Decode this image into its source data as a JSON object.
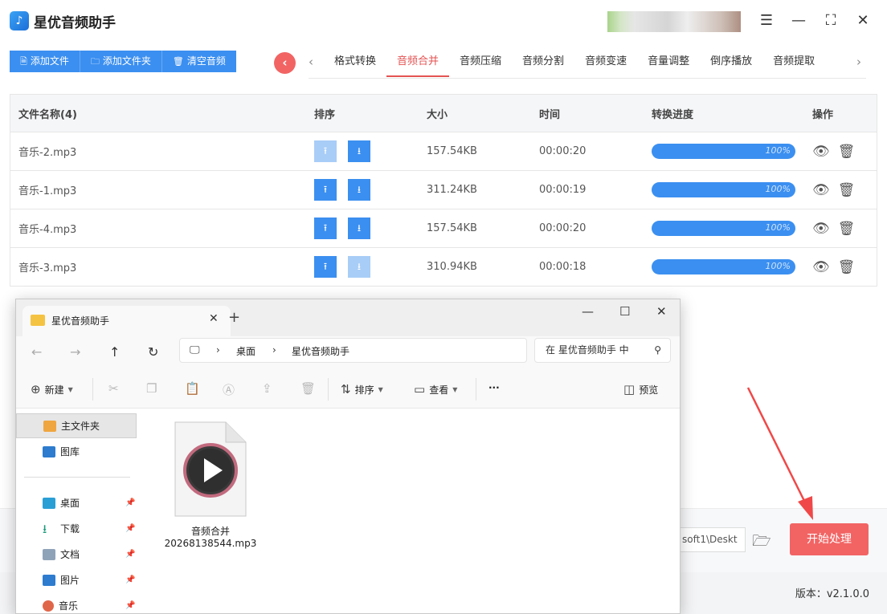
{
  "app": {
    "title": "星优音频助手",
    "version": "版本：v2.1.0.0"
  },
  "toolbar": {
    "add_file": "添加文件",
    "add_folder": "添加文件夹",
    "clear_audio": "清空音频"
  },
  "tabs": [
    "格式转换",
    "音频合并",
    "音频压缩",
    "音频分割",
    "音频变速",
    "音量调整",
    "倒序播放",
    "音频提取"
  ],
  "active_tab": "音频合并",
  "table": {
    "headers": {
      "name": "文件名称(4)",
      "sort": "排序",
      "size": "大小",
      "time": "时间",
      "progress": "转换进度",
      "ops": "操作"
    },
    "rows": [
      {
        "name": "音乐-2.mp3",
        "size": "157.54KB",
        "time": "00:00:20",
        "progress_text": "100%",
        "progress": 1.0,
        "up_enabled": false,
        "down_enabled": true
      },
      {
        "name": "音乐-1.mp3",
        "size": "311.24KB",
        "time": "00:00:19",
        "progress_text": "100%",
        "progress": 1.0,
        "up_enabled": true,
        "down_enabled": true
      },
      {
        "name": "音乐-4.mp3",
        "size": "157.54KB",
        "time": "00:00:20",
        "progress_text": "100%",
        "progress": 1.0,
        "up_enabled": true,
        "down_enabled": true
      },
      {
        "name": "音乐-3.mp3",
        "size": "310.94KB",
        "time": "00:00:18",
        "progress_text": "100%",
        "progress": 1.0,
        "up_enabled": true,
        "down_enabled": false
      }
    ]
  },
  "output": {
    "path": "soft1\\Deskt",
    "start_button": "开始处理"
  },
  "explorer": {
    "tab_title": "星优音频助手",
    "address": [
      "桌面",
      "星优音频助手"
    ],
    "search_placeholder": "在 星优音频助手 中",
    "commands": {
      "new": "新建",
      "sort": "排序",
      "view": "查看",
      "more": "···",
      "preview": "预览"
    },
    "sidebar": [
      {
        "label": "主文件夹",
        "selected": true,
        "pinned": false
      },
      {
        "label": "图库",
        "selected": false,
        "pinned": false
      },
      {
        "label": "桌面",
        "selected": false,
        "pinned": true
      },
      {
        "label": "下载",
        "selected": false,
        "pinned": true
      },
      {
        "label": "文档",
        "selected": false,
        "pinned": true
      },
      {
        "label": "图片",
        "selected": false,
        "pinned": true
      },
      {
        "label": "音乐",
        "selected": false,
        "pinned": true
      }
    ],
    "file": {
      "name_line1": "音频合并",
      "name_line2": "20268138544.mp3"
    }
  },
  "colors": {
    "primary": "#3b8ff0",
    "accent": "#f26464",
    "active_tab": "#e45353"
  }
}
